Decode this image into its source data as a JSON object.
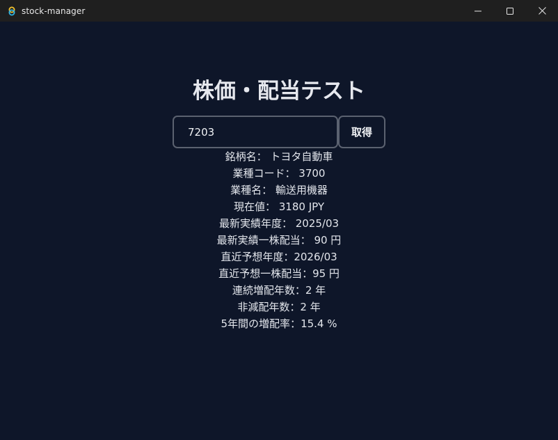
{
  "window": {
    "title": "stock-manager"
  },
  "page": {
    "title": "株価・配当テスト"
  },
  "search": {
    "value": "7203",
    "button_label": "取得"
  },
  "info": [
    {
      "label": "銘柄名：",
      "value": " トヨタ自動車"
    },
    {
      "label": "業種コード：",
      "value": " 3700"
    },
    {
      "label": "業種名：",
      "value": " 輸送用機器"
    },
    {
      "label": "現在値：",
      "value": " 3180 JPY"
    },
    {
      "label": "最新実績年度：",
      "value": " 2025/03"
    },
    {
      "label": "最新実績一株配当：",
      "value": " 90 円"
    },
    {
      "label": "直近予想年度：",
      "value": "2026/03"
    },
    {
      "label": "直近予想一株配当：",
      "value": "95 円"
    },
    {
      "label": "連続増配年数：",
      "value": "2 年"
    },
    {
      "label": "非減配年数：",
      "value": "2 年"
    },
    {
      "label": "5年間の増配率：",
      "value": "15.4 %"
    }
  ],
  "colors": {
    "background": "#0e1629",
    "titlebar": "#1f1f1f",
    "border": "#5b6270",
    "text": "#e3e6ec"
  }
}
